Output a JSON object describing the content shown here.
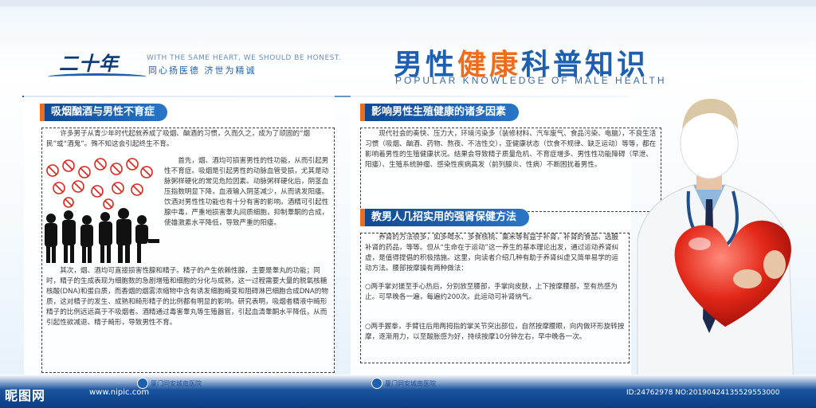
{
  "header": {
    "logo_text": "二十年",
    "logo_en": "WITH THE SAME HEART, WE SHOULD BE HONEST.",
    "logo_cn": "同心扬医德  济世为精诚",
    "title_part1": "男性",
    "title_part2": "健康",
    "title_part3": "科普知识",
    "subtitle": "POPULAR KNOWLEDGE OF MALE HEALTH"
  },
  "left_panel": {
    "heading": "吸烟酗酒与男性不育症",
    "p1": "许多男子从青少年时代起就养成了吸烟、酗酒的习惯，久而久之，成为了顽固的“烟民”或“酒鬼”。殊不知这会引起终生不育。",
    "p2": "首先，烟、酒均可损害男性的性功能，从而引起男性不育症。吸烟是引起男性的动脉血管受损，尤其是动脉粥样硬化的常见危险因素。动脉粥样硬化后，阴茎血压指数明显下降，血液输入阴茎减少，从而诱发阳痿。饮酒对男性性功能也有十分有害的影响。酒精可引起性腺中毒，严重地损害睾丸间质细胞，抑制睾酮的合成，使雄激素水平降低，导致严重的阳痿。",
    "p3": "其次，烟、酒均可直接损害性腺和精子。精子的产生依赖性腺，主要是睾丸的功能；同时，精子的生成表现为细胞数的急剧增殖和细胞的分化与成熟，这一过程需要大量的脱氧核糖核酸(DNA)和蛋白质，而香烟的烟雾浓缩物中含有诱发细胞畸变和阻碍淋巴细胞合成DNA的物质，这对精子的发生、成熟和畸形精子的比例都有明显的影响。研究表明，吸烟者精液中畸形精子的比例远远高于不吸烟者。酒精通过毒害睾丸等生殖器官，引起血清睾酮水平降低，从而引起性欲减退、精子畸形，导致男性不育。",
    "footer_label": "厦门同安城南医院"
  },
  "right_panel": {
    "heading1": "影响男性生殖健康的诸多因素",
    "p1": "现代社会的奏快、压力大，环境污染多（装修材料、汽车废气、食品污染、电脑），不良生活习惯（吸烟、酗酒、药物、熬夜、不洁性交），亚健康状态（饮食不规律、缺乏运动）等等，都在影响着男性的生殖健康状况。结果会导致精子质量危机、不育症增多、男性性功能障碍（早泄、阳痿）、生殖系统肿瘤、感染性疾病高发（前列腺炎、性病）不断困扰着男性。",
    "heading2": "教男人几招实用的强肾保健方法",
    "p2": "养肾的方法很多，如多喝水、多食核桃、粟米等有益于补肾，补肾的食品、选服补肾的药品，等等。但从“生命在于运动”这一养生的基本理论出发，通过运动养肾纠虚，是值得提倡的积极措施。这里，向读者介绍几种有助于养肾纠虚又简单易学的运动方法。腰部按摩操有两种做法：",
    "p3": "○两手掌对搓至手心热后，分别放至腰部，手掌向皮肤，上下按摩腰部，至有热感为止。可早晚各一遍，每遍约200次。此运动可补肾纳气。",
    "p4": "○两手握拳，手臂往后用两拇指的掌关节突出部位，自然按摩腰眼，向内做环形旋转按摩，逐渐用力，以至酸胀感为好，持续按摩10分钟左右，早中晚各一次。",
    "footer_label": "厦门同安城南医院"
  },
  "watermark": {
    "brand": "昵图网",
    "url": "www.nipic.com",
    "id": "ID:24762978 NO:20190424135529553000"
  },
  "icons": {
    "no_smoking": "no-smoking-icon",
    "doctor": "doctor-holding-heart-image",
    "silhouettes": "people-silhouettes-image"
  },
  "colors": {
    "primary_blue": "#1d5fb0",
    "accent_orange": "#ef6c1a",
    "heading_blue": "#0f4a94"
  }
}
